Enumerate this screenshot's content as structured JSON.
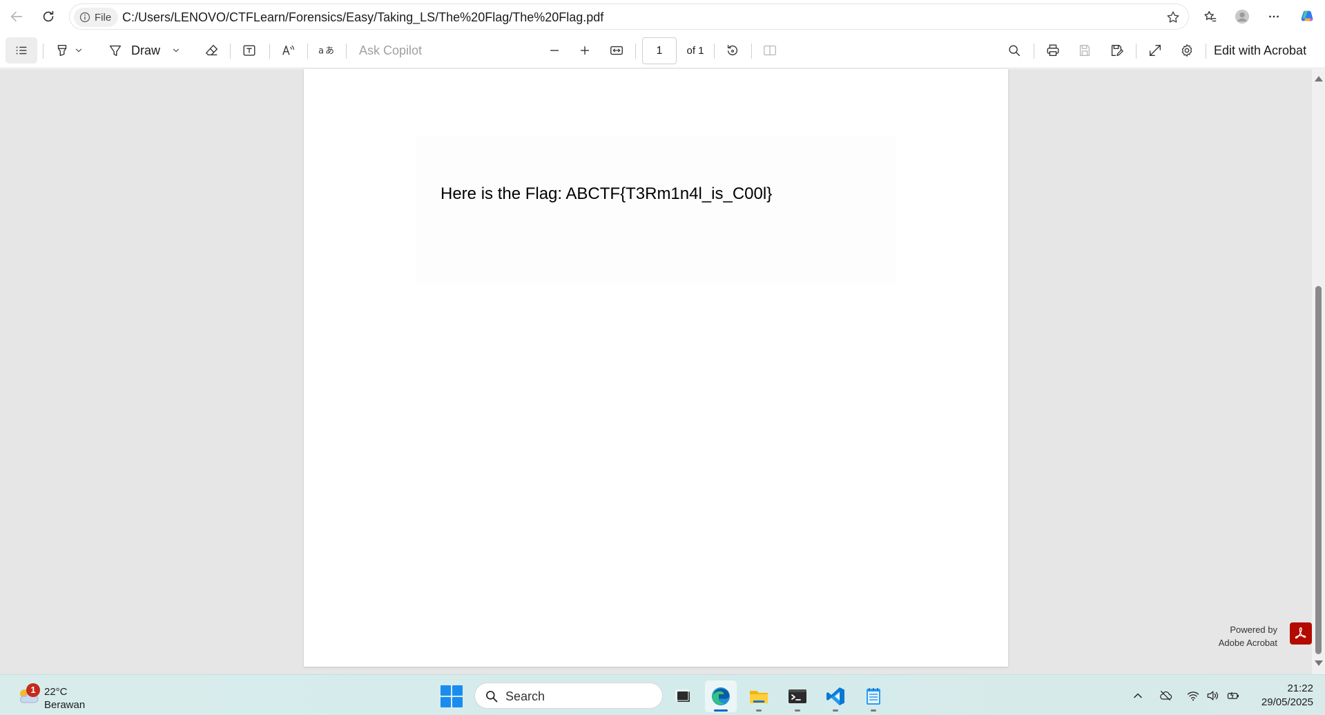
{
  "browser": {
    "file_chip_label": "File",
    "url": "C:/Users/LENOVO/CTFLearn/Forensics/Easy/Taking_LS/The%20Flag/The%20Flag.pdf"
  },
  "pdf_toolbar": {
    "draw_label": "Draw",
    "ask_copilot_label": "Ask Copilot",
    "page_number": "1",
    "page_total": "of 1",
    "edit_label": "Edit with Acrobat"
  },
  "document": {
    "content": "Here is the Flag: ABCTF{T3Rm1n4l_is_C00l}",
    "powered_by_line1": "Powered by",
    "powered_by_line2": "Adobe Acrobat"
  },
  "taskbar": {
    "weather_badge": "1",
    "temperature": "22°C",
    "weather_desc": "Berawan",
    "search_label": "Search",
    "time": "21:22",
    "date": "29/05/2025"
  },
  "colors": {
    "acrobat_red": "#b30b00",
    "windows_blue": "#1a8cf0",
    "active_indicator": "#0067c0"
  }
}
